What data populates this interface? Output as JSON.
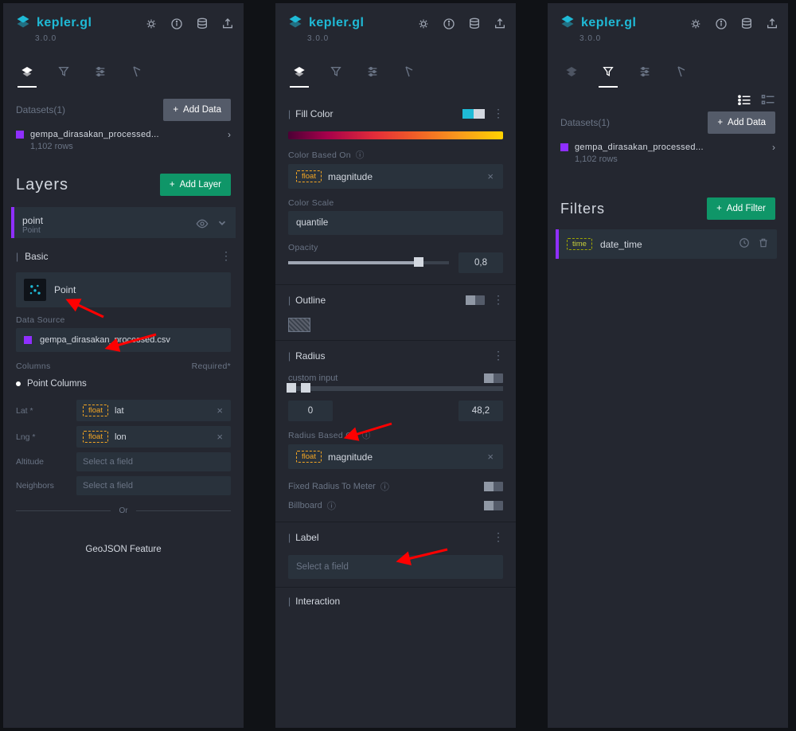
{
  "brand": {
    "name": "kepler.gl",
    "version": "3.0.0"
  },
  "panel1": {
    "datasets_label": "Datasets(1)",
    "add_data": "Add Data",
    "dataset_name": "gempa_dirasakan_processed...",
    "rows": "1,102 rows",
    "layers_title": "Layers",
    "add_layer": "Add Layer",
    "layer": {
      "name": "point",
      "type": "Point"
    },
    "basic": "Basic",
    "type_label": "Point",
    "data_source": "Data Source",
    "source_file": "gempa_dirasakan_processed.csv",
    "columns": "Columns",
    "required": "Required*",
    "point_columns": "Point Columns",
    "lat_label": "Lat *",
    "lat_type": "float",
    "lat_val": "lat",
    "lng_label": "Lng *",
    "lng_type": "float",
    "lng_val": "lon",
    "altitude": "Altitude",
    "neighbors": "Neighbors",
    "placeholder": "Select a field",
    "or": "Or",
    "geojson": "GeoJSON Feature"
  },
  "panel2": {
    "fill_color": "Fill Color",
    "cbo": "Color Based On",
    "field_type": "float",
    "field_val": "magnitude",
    "color_scale": "Color Scale",
    "scale_val": "quantile",
    "opacity": "Opacity",
    "opacity_val": "0,8",
    "outline": "Outline",
    "radius": "Radius",
    "custom_input": "custom input",
    "r_min": "0",
    "r_max": "48,2",
    "rbo": "Radius Based On",
    "r_field_type": "float",
    "r_field_val": "magnitude",
    "fixed": "Fixed Radius To Meter",
    "billboard": "Billboard",
    "label": "Label",
    "label_placeholder": "Select a field",
    "interaction": "Interaction"
  },
  "panel3": {
    "datasets_label": "Datasets(1)",
    "add_data": "Add Data",
    "dataset_name": "gempa_dirasakan_processed...",
    "rows": "1,102 rows",
    "filters_title": "Filters",
    "add_filter": "Add Filter",
    "filter_type": "time",
    "filter_field": "date_time"
  }
}
